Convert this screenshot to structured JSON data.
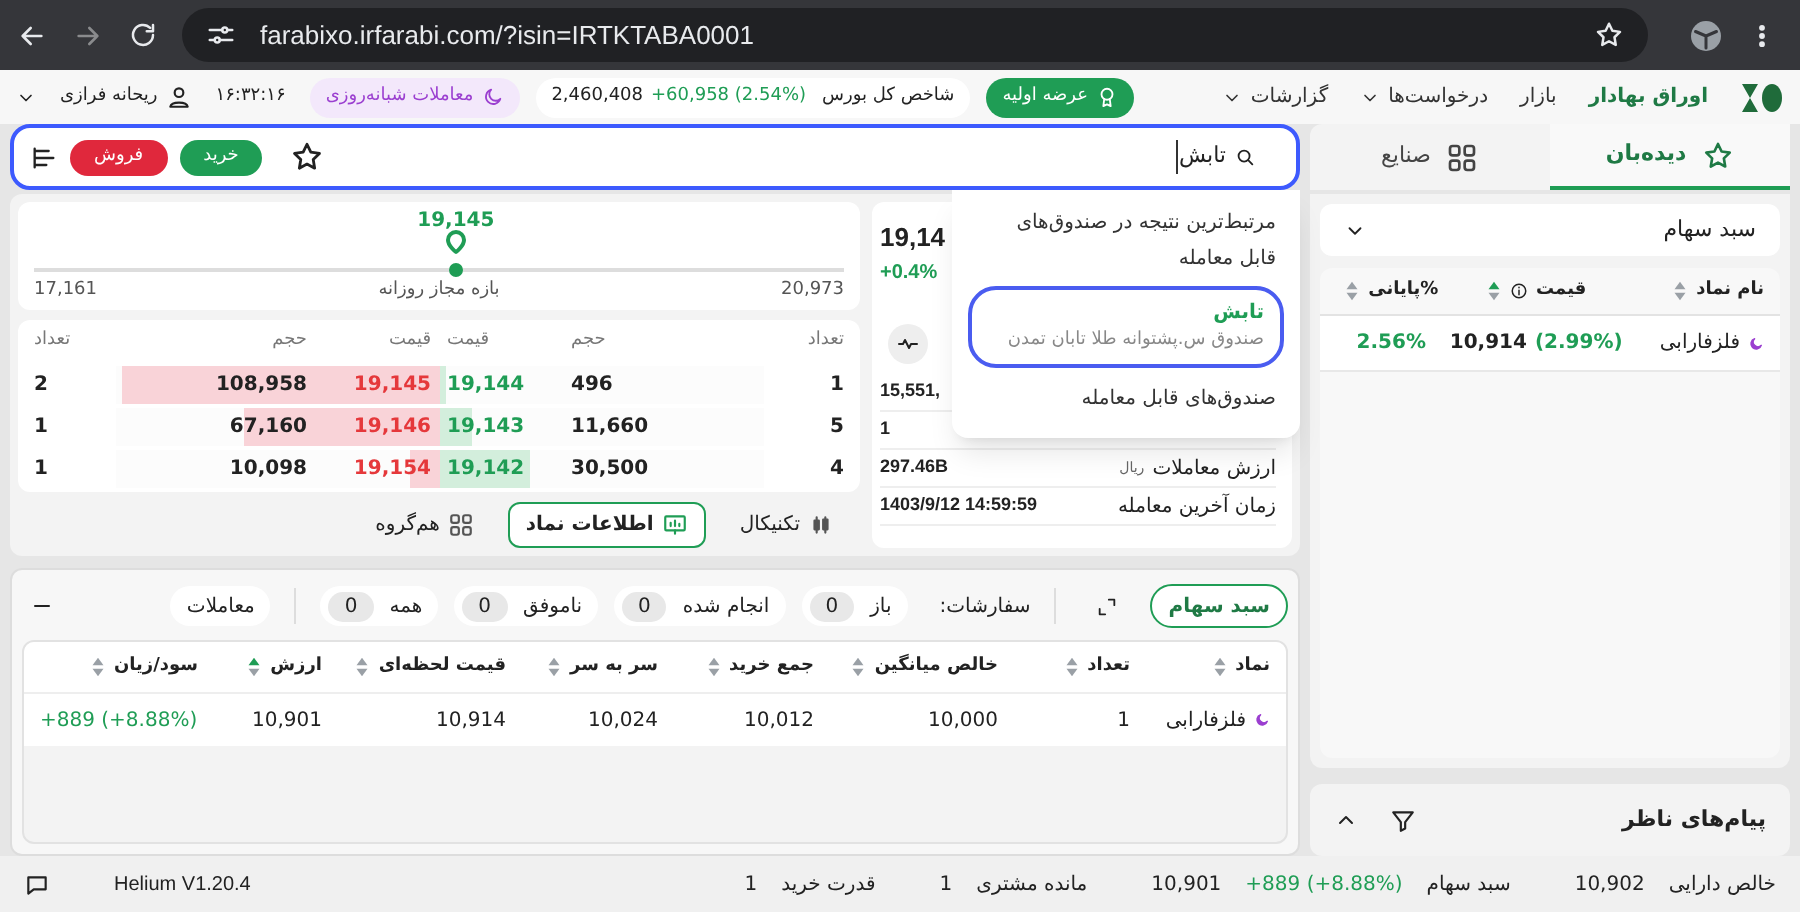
{
  "browser": {
    "url": "farabixo.irfarabi.com/?isin=IRTKTABA0001"
  },
  "header": {
    "nav": [
      {
        "label": "اوراق بهادار",
        "selected": true,
        "dropdown": false
      },
      {
        "label": "بازار",
        "selected": false,
        "dropdown": false
      },
      {
        "label": "درخواست‌ها",
        "selected": false,
        "dropdown": true
      },
      {
        "label": "گزارشات",
        "selected": false,
        "dropdown": true
      }
    ],
    "ipo_button": "عرضه اولیه",
    "index": {
      "label": "شاخص کل بورس",
      "value": "2,460,408",
      "change": "+60,958",
      "percent": "(2.54%)"
    },
    "night_trading": "معاملات شبانه‌روزی",
    "clock": "۱۶:۳۲:۱۶",
    "user": "ریحانه فرازی"
  },
  "toolbar": {
    "search": "تابش",
    "buy": "خرید",
    "sell": "فروش"
  },
  "right_tabs": [
    {
      "label": "دیده‌بان",
      "selected": true
    },
    {
      "label": "صنایع",
      "selected": false
    }
  ],
  "price_range": {
    "current": "19,145",
    "min": "17,161",
    "max": "20,973",
    "label": "بازه مجاز روزانه",
    "level": 0.52
  },
  "order_book": {
    "columns": [
      "تعداد",
      "حجم",
      "قیمت",
      "قیمت",
      "حجم",
      "تعداد"
    ],
    "rows": [
      {
        "buy": {
          "count": "1",
          "volume": "496",
          "price": "19,144",
          "level": 0.02
        },
        "sell": {
          "price": "19,145",
          "volume": "108,958",
          "count": "2",
          "level": 0.98
        }
      },
      {
        "buy": {
          "count": "5",
          "volume": "11,660",
          "price": "19,143",
          "level": 0.1
        },
        "sell": {
          "price": "19,146",
          "volume": "67,160",
          "count": "1",
          "level": 0.6
        }
      },
      {
        "buy": {
          "count": "4",
          "volume": "30,500",
          "price": "19,142",
          "level": 0.28
        },
        "sell": {
          "price": "19,154",
          "volume": "10,098",
          "count": "1",
          "level": 0.09
        }
      }
    ]
  },
  "left_tabs": [
    {
      "label": "تکنیکال",
      "selected": false
    },
    {
      "label": "اطلاعات نماد",
      "selected": true
    },
    {
      "label": "هم‌گروه",
      "selected": false
    }
  ],
  "symbol_card": {
    "price": "19,14",
    "change": "+0.4%",
    "rows": [
      {
        "value": "15,551,"
      },
      {
        "value": "1"
      },
      {
        "label": "ارزش معاملات",
        "unit": "ریال",
        "value": "297.46B"
      },
      {
        "label": "زمان آخرین معامله",
        "value": "1403/9/12 14:59:59"
      }
    ]
  },
  "search_dropdown": {
    "heading": "مرتبط‌ترین نتیجه در صندوق‌های قابل معامله",
    "result": {
      "symbol": "تابش",
      "name": "صندوق س.پشتوانه طلا تابان تمدن",
      "selected": true
    },
    "footer": "صندوق‌های قابل معامله"
  },
  "watchlist": {
    "basket": "سبد سهام",
    "columns": [
      {
        "label": "نام نماد",
        "sorted": false,
        "info": false
      },
      {
        "label": "قیمت",
        "sorted": true,
        "info": true
      },
      {
        "label": "%پایانی",
        "sorted": false,
        "info": false
      }
    ],
    "rows": [
      {
        "symbol": "فلزفارابی",
        "price": "10,914",
        "change": "(2.99%)",
        "close_pct": "2.56%"
      }
    ]
  },
  "monitor_messages": "پیام‌های ناظر",
  "portfolio": {
    "basket_button": "سبد سهام",
    "orders_label": "سفارشات:",
    "filters": [
      {
        "label": "باز",
        "count": "0"
      },
      {
        "label": "انجام شده",
        "count": "0"
      },
      {
        "label": "ناموفق",
        "count": "0"
      },
      {
        "label": "همه",
        "count": "0"
      }
    ],
    "trades": "معاملات",
    "columns": [
      {
        "label": "نماد",
        "sorted": false
      },
      {
        "label": "تعداد",
        "sorted": false
      },
      {
        "label": "خالص میانگین",
        "sorted": false
      },
      {
        "label": "جمع خرید",
        "sorted": false
      },
      {
        "label": "سر به سر",
        "sorted": false
      },
      {
        "label": "قیمت لحظه‌ای",
        "sorted": false
      },
      {
        "label": "ارزش",
        "sorted": true
      },
      {
        "label": "سود/زیان",
        "sorted": false
      }
    ],
    "rows": [
      [
        "فلزفارابی",
        "1",
        "10,000",
        "10,012",
        "10,024",
        "10,914",
        "10,901",
        "+889 (+8.88%)"
      ]
    ]
  },
  "status_bar": {
    "items": [
      {
        "label": "خالص دارایی",
        "value": "10,902"
      },
      {
        "label": "سبد سهام",
        "value": "10,901",
        "change": "+889 (+8.88%)"
      },
      {
        "label": "مانده مشتری",
        "value": "1"
      },
      {
        "label": "قدرت خرید",
        "value": "1"
      }
    ],
    "version": "Helium V1.20.4"
  }
}
